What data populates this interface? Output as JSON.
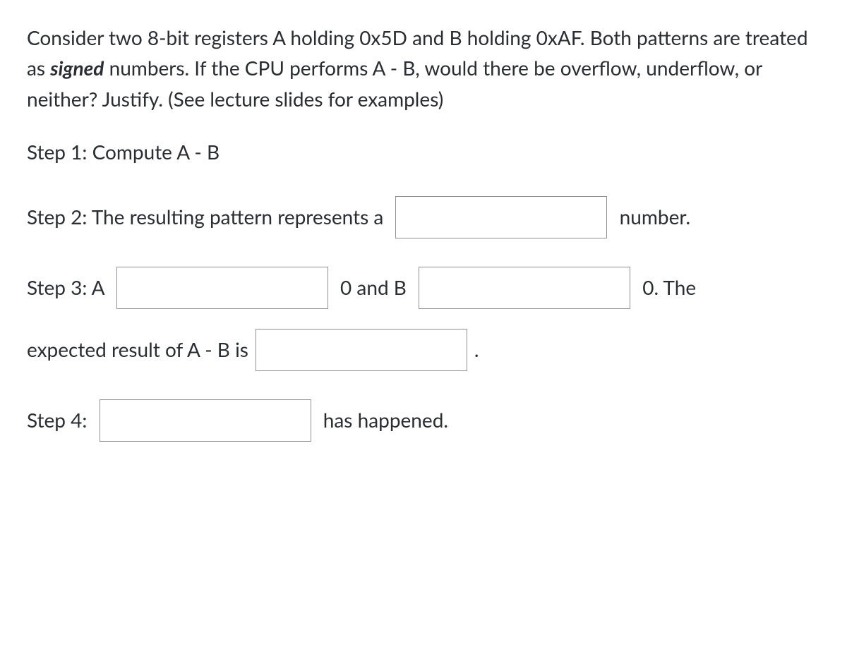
{
  "intro": {
    "part1": "Consider two 8-bit registers A holding 0x5D and B holding 0xAF. Both patterns are treated as ",
    "signed_word": "signed",
    "part2": " numbers. If the CPU performs A - B, would there be overflow, underflow, or neither? Justify. (See lecture slides for examples)"
  },
  "step1": {
    "text": "Step 1: Compute A - B"
  },
  "step2": {
    "before": "Step 2: The resulting pattern represents a ",
    "after": " number."
  },
  "step3": {
    "t1": "Step 3: A ",
    "t2": " 0 and B ",
    "t3": " 0. The",
    "t4": "expected result of A - B is ",
    "t5": " ."
  },
  "step4": {
    "before": "Step 4: ",
    "after": " has happened."
  },
  "blanks": {
    "step2_sign": "",
    "step3_a_rel": "",
    "step3_b_rel": "",
    "step3_expected": "",
    "step4_result": ""
  }
}
